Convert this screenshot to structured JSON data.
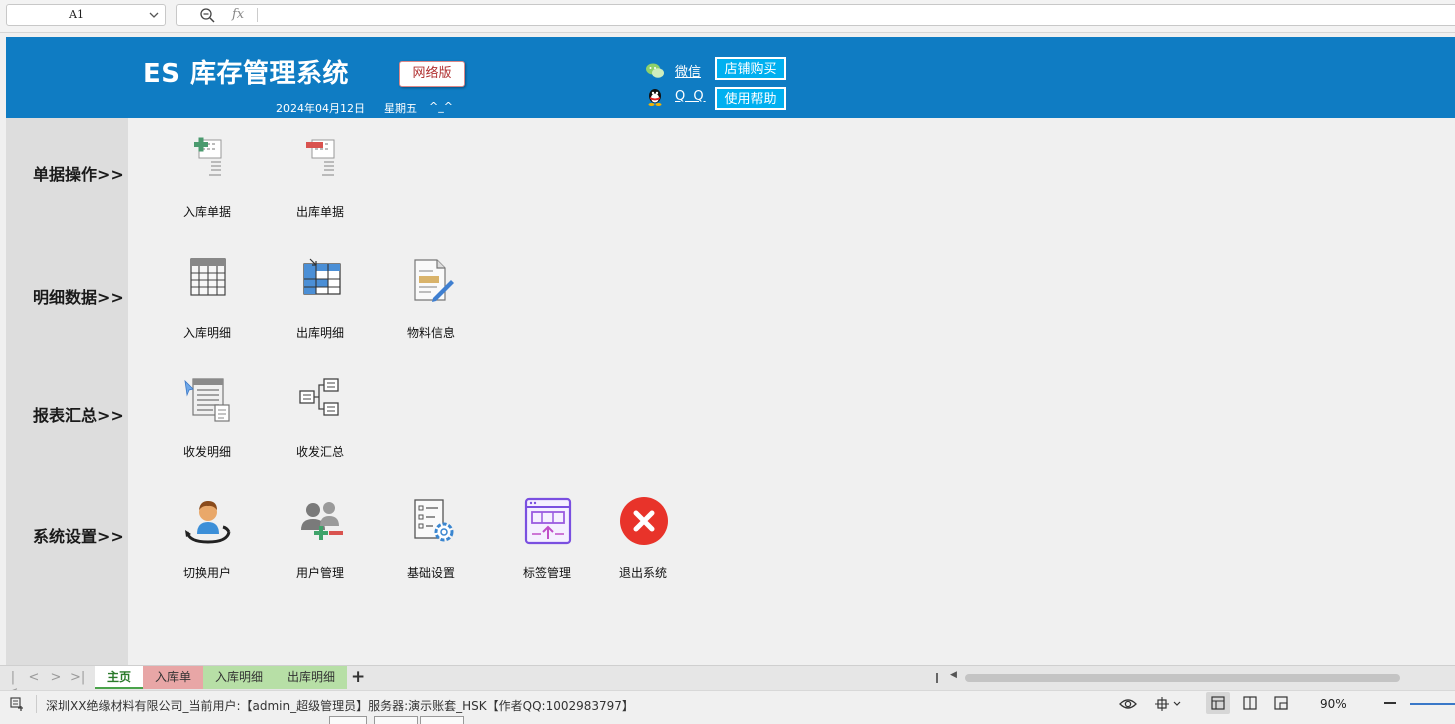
{
  "formula_bar": {
    "cell_ref": "A1",
    "fx": "fx"
  },
  "header": {
    "title": "ES 库存管理系统",
    "edition": "网络版",
    "date": "2024年04月12日",
    "weekday": "星期五",
    "smile": "^_^",
    "wechat": "微信",
    "qq": "Q Q",
    "shop_button": "店铺购买",
    "help_button": "使用帮助",
    "colors": {
      "header_bg": "#0f7cc3",
      "accent_button": "#00b0f0"
    }
  },
  "sections": [
    {
      "label": "单据操作>>",
      "items": [
        {
          "label": "入库单据",
          "icon": "stock-in-doc-icon"
        },
        {
          "label": "出库单据",
          "icon": "stock-out-doc-icon"
        }
      ]
    },
    {
      "label": "明细数据>>",
      "items": [
        {
          "label": "入库明细",
          "icon": "table-grid-icon"
        },
        {
          "label": "出库明细",
          "icon": "table-export-icon"
        },
        {
          "label": "物料信息",
          "icon": "document-edit-icon"
        }
      ]
    },
    {
      "label": "报表汇总>>",
      "items": [
        {
          "label": "收发明细",
          "icon": "report-list-icon"
        },
        {
          "label": "收发汇总",
          "icon": "tree-summary-icon"
        }
      ]
    },
    {
      "label": "系统设置>>",
      "items": [
        {
          "label": "切换用户",
          "icon": "switch-user-icon"
        },
        {
          "label": "用户管理",
          "icon": "user-group-icon"
        },
        {
          "label": "基础设置",
          "icon": "settings-doc-icon"
        },
        {
          "label": "标签管理",
          "icon": "label-window-icon"
        },
        {
          "label": "退出系统",
          "icon": "exit-icon"
        }
      ]
    }
  ],
  "tabs": [
    "主页",
    "入库单",
    "入库明细",
    "出库明细"
  ],
  "status_bar": {
    "text": "深圳XX绝缘材料有限公司_当前用户:【admin_超级管理员】服务器:演示账套_HSK【作者QQ:1002983797】",
    "zoom": "90%"
  }
}
